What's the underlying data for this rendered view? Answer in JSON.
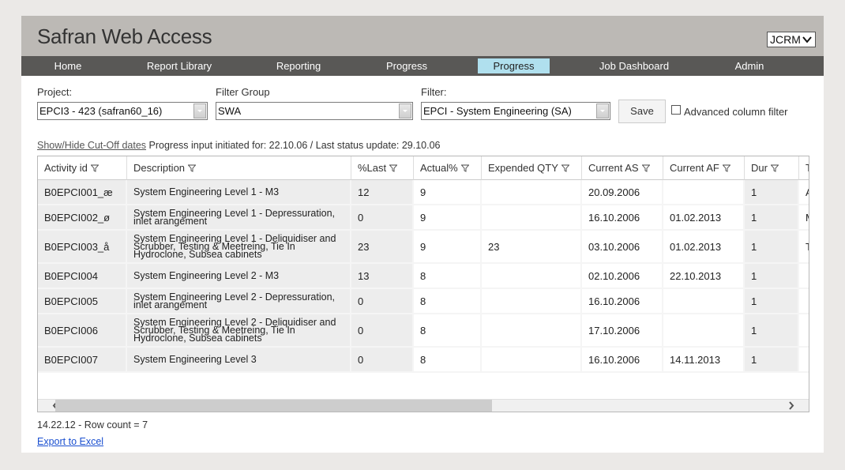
{
  "header": {
    "title": "Safran Web Access",
    "user_select": "JCRM"
  },
  "nav": {
    "items": [
      {
        "label": "Home",
        "active": false
      },
      {
        "label": "Report Library",
        "active": false
      },
      {
        "label": "Reporting",
        "active": false
      },
      {
        "label": "Progress",
        "active": false
      },
      {
        "label": "Progress",
        "active": true
      },
      {
        "label": "Job Dashboard",
        "active": false
      },
      {
        "label": "Admin",
        "active": false
      }
    ],
    "active_color": "#b0e0ee"
  },
  "filters": {
    "project_label": "Project:",
    "project_value": "EPCI3 - 423 (safran60_16)",
    "filter_group_label": "Filter Group",
    "filter_group_value": "SWA",
    "filter_label": "Filter:",
    "filter_value": "EPCI - System Engineering (SA)",
    "save_label": "Save",
    "advanced_filter_label": "Advanced column filter",
    "advanced_filter_checked": false
  },
  "status": {
    "cutoff_link": "Show/Hide Cut-Off dates",
    "text": "Progress input initiated for: 22.10.06 / Last status update: 29.10.06"
  },
  "grid": {
    "columns": [
      "Activity id",
      "Description",
      "%Last",
      "Actual%",
      "Expended QTY",
      "Current AS",
      "Current AF",
      "Dur",
      "T"
    ],
    "rows": [
      {
        "id": "B0EPCI001_æ",
        "desc": "System Engineering Level 1 - M3",
        "last": "12",
        "actual": "9",
        "qty": "",
        "as": "20.09.2006",
        "af": "",
        "dur": "1",
        "t": "A"
      },
      {
        "id": "B0EPCI002_ø",
        "desc": "System Engineering Level 1 - Depressuration, inlet arangement",
        "last": "0",
        "actual": "9",
        "qty": "",
        "as": "16.10.2006",
        "af": "01.02.2013",
        "dur": "1",
        "t": "M"
      },
      {
        "id": "B0EPCI003_å",
        "desc": "System Engineering Level 1 - Deliquidiser and Scrubber, Testing & Meetreing, Tie In Hydroclone, Subsea cabinets",
        "last": "23",
        "actual": "9",
        "qty": "23",
        "as": "03.10.2006",
        "af": "01.02.2013",
        "dur": "1",
        "t": "T"
      },
      {
        "id": "B0EPCI004",
        "desc": "System Engineering Level 2 - M3",
        "last": "13",
        "actual": "8",
        "qty": "",
        "as": "02.10.2006",
        "af": "22.10.2013",
        "dur": "1",
        "t": ""
      },
      {
        "id": "B0EPCI005",
        "desc": "System Engineering Level 2 - Depressuration, inlet arangement",
        "last": "0",
        "actual": "8",
        "qty": "",
        "as": "16.10.2006",
        "af": "",
        "dur": "1",
        "t": ""
      },
      {
        "id": "B0EPCI006",
        "desc": "System Engineering Level 2 - Deliquidiser and Scrubber, Testing & Meetreing, Tie In Hydroclone, Subsea cabinets",
        "last": "0",
        "actual": "8",
        "qty": "",
        "as": "17.10.2006",
        "af": "",
        "dur": "1",
        "t": ""
      },
      {
        "id": "B0EPCI007",
        "desc": "System Engineering Level 3",
        "last": "0",
        "actual": "8",
        "qty": "",
        "as": "16.10.2006",
        "af": "14.11.2013",
        "dur": "1",
        "t": ""
      }
    ]
  },
  "footer": {
    "row_count_text": "14.22.12 - Row count = 7",
    "export_link": "Export to Excel"
  }
}
